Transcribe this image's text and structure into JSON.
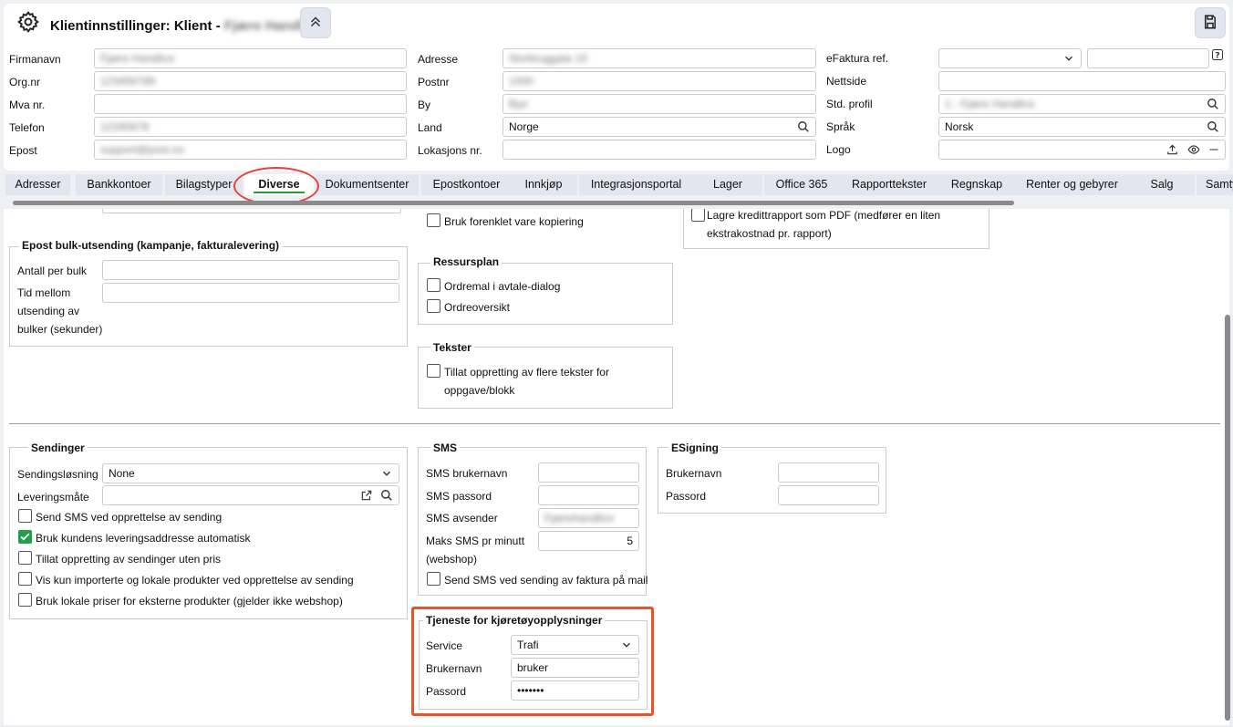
{
  "header": {
    "title": "Klientinnstillinger: Klient -",
    "title_client": "Fjære Handlice",
    "settings_icon": "gear-icon",
    "collapse_icon": "chevrons-up-icon",
    "save_icon": "save-icon"
  },
  "client": {
    "firmanavn_label": "Firmanavn",
    "firmanavn": "Fjære Handlice",
    "orgnr_label": "Org.nr",
    "orgnr": "123456789",
    "mva_label": "Mva nr.",
    "mva": "",
    "telefon_label": "Telefon",
    "telefon": "12345678",
    "epost_label": "Epost",
    "epost": "support@post.no",
    "adresse_label": "Adresse",
    "adresse": "Storbruggata 10",
    "postnr_label": "Postnr",
    "postnr": "1000",
    "by_label": "By",
    "by": "Bye",
    "land_label": "Land",
    "land": "Norge",
    "lokasjon_label": "Lokasjons nr.",
    "lokasjon": "",
    "efaktura_label": "eFaktura ref.",
    "efaktura": "",
    "efaktura2": "",
    "nettside_label": "Nettside",
    "nettside": "",
    "stdprofil_label": "Std. profil",
    "stdprofil": "1 - Fjære Handlice",
    "sprak_label": "Språk",
    "sprak": "Norsk",
    "logo_label": "Logo",
    "logo": ""
  },
  "tabs": [
    {
      "label": "Adresser"
    },
    {
      "label": "Bankkontoer"
    },
    {
      "label": "Bilagstyper"
    },
    {
      "label": "Diverse"
    },
    {
      "label": "Dokumentsenter"
    },
    {
      "label": "Epostkontoer"
    },
    {
      "label": "Innkjøp"
    },
    {
      "label": "Integrasjonsportal"
    },
    {
      "label": "Lager"
    },
    {
      "label": "Office 365"
    },
    {
      "label": "Rapporttekster"
    },
    {
      "label": "Regnskap"
    },
    {
      "label": "Renter og gebyrer"
    },
    {
      "label": "Salg"
    },
    {
      "label": "Samty"
    }
  ],
  "top": {
    "bruk_forenklet": "Bruk forenklet vare kopiering",
    "lagre_kreditt_1": "Lagre kredittrapport som PDF (medfører en liten",
    "lagre_kreditt_2": "ekstrakostnad pr. rapport)"
  },
  "epost_bulk": {
    "legend": "Epost bulk-utsending (kampanje, fakturalevering)",
    "antall_label": "Antall per bulk",
    "tid_1": "Tid mellom",
    "tid_2": "utsending av",
    "tid_3": "bulker (sekunder)",
    "antall": "",
    "tid": ""
  },
  "ressursplan": {
    "legend": "Ressursplan",
    "ordremal": "Ordremal i avtale-dialog",
    "ordreoversikt": "Ordreoversikt"
  },
  "tekster": {
    "legend": "Tekster",
    "tillat_1": "Tillat oppretting av flere tekster for",
    "tillat_2": "oppgave/blokk"
  },
  "sendinger": {
    "legend": "Sendinger",
    "losning_label": "Sendingsløsning",
    "losning": "None",
    "leveringsmate_label": "Leveringsmåte",
    "leveringsmate": "",
    "cb1": "Send SMS ved opprettelse av sending",
    "cb2": "Bruk kundens leveringsaddresse automatisk",
    "cb3": "Tillat oppretting av sendinger uten pris",
    "cb4": "Vis kun importerte og lokale produkter ved opprettelse av sending",
    "cb5": "Bruk lokale priser for eksterne produkter (gjelder ikke webshop)"
  },
  "sms": {
    "legend": "SMS",
    "brukernavn_label": "SMS brukernavn",
    "brukernavn": "",
    "passord_label": "SMS passord",
    "passord": "",
    "avsender_label": "SMS avsender",
    "avsender": "Fjærehandlice",
    "maks_1": "Maks SMS pr minutt",
    "maks_2": "(webshop)",
    "maks": "5",
    "send_faktura": "Send SMS ved sending av faktura på mail"
  },
  "esigning": {
    "legend": "ESigning",
    "brukernavn_label": "Brukernavn",
    "brukernavn": "",
    "passord_label": "Passord",
    "passord": ""
  },
  "kjoretoy": {
    "legend": "Tjeneste for kjøretøyopplysninger",
    "service_label": "Service",
    "service": "Trafi",
    "brukernavn_label": "Brukernavn",
    "brukernavn": "bruker",
    "passord_label": "Passord",
    "passord": "•••••••"
  },
  "colors": {
    "accent_green": "#22a04b",
    "highlight_orange": "#e8532a",
    "tab_bg": "#e2e6ee"
  }
}
